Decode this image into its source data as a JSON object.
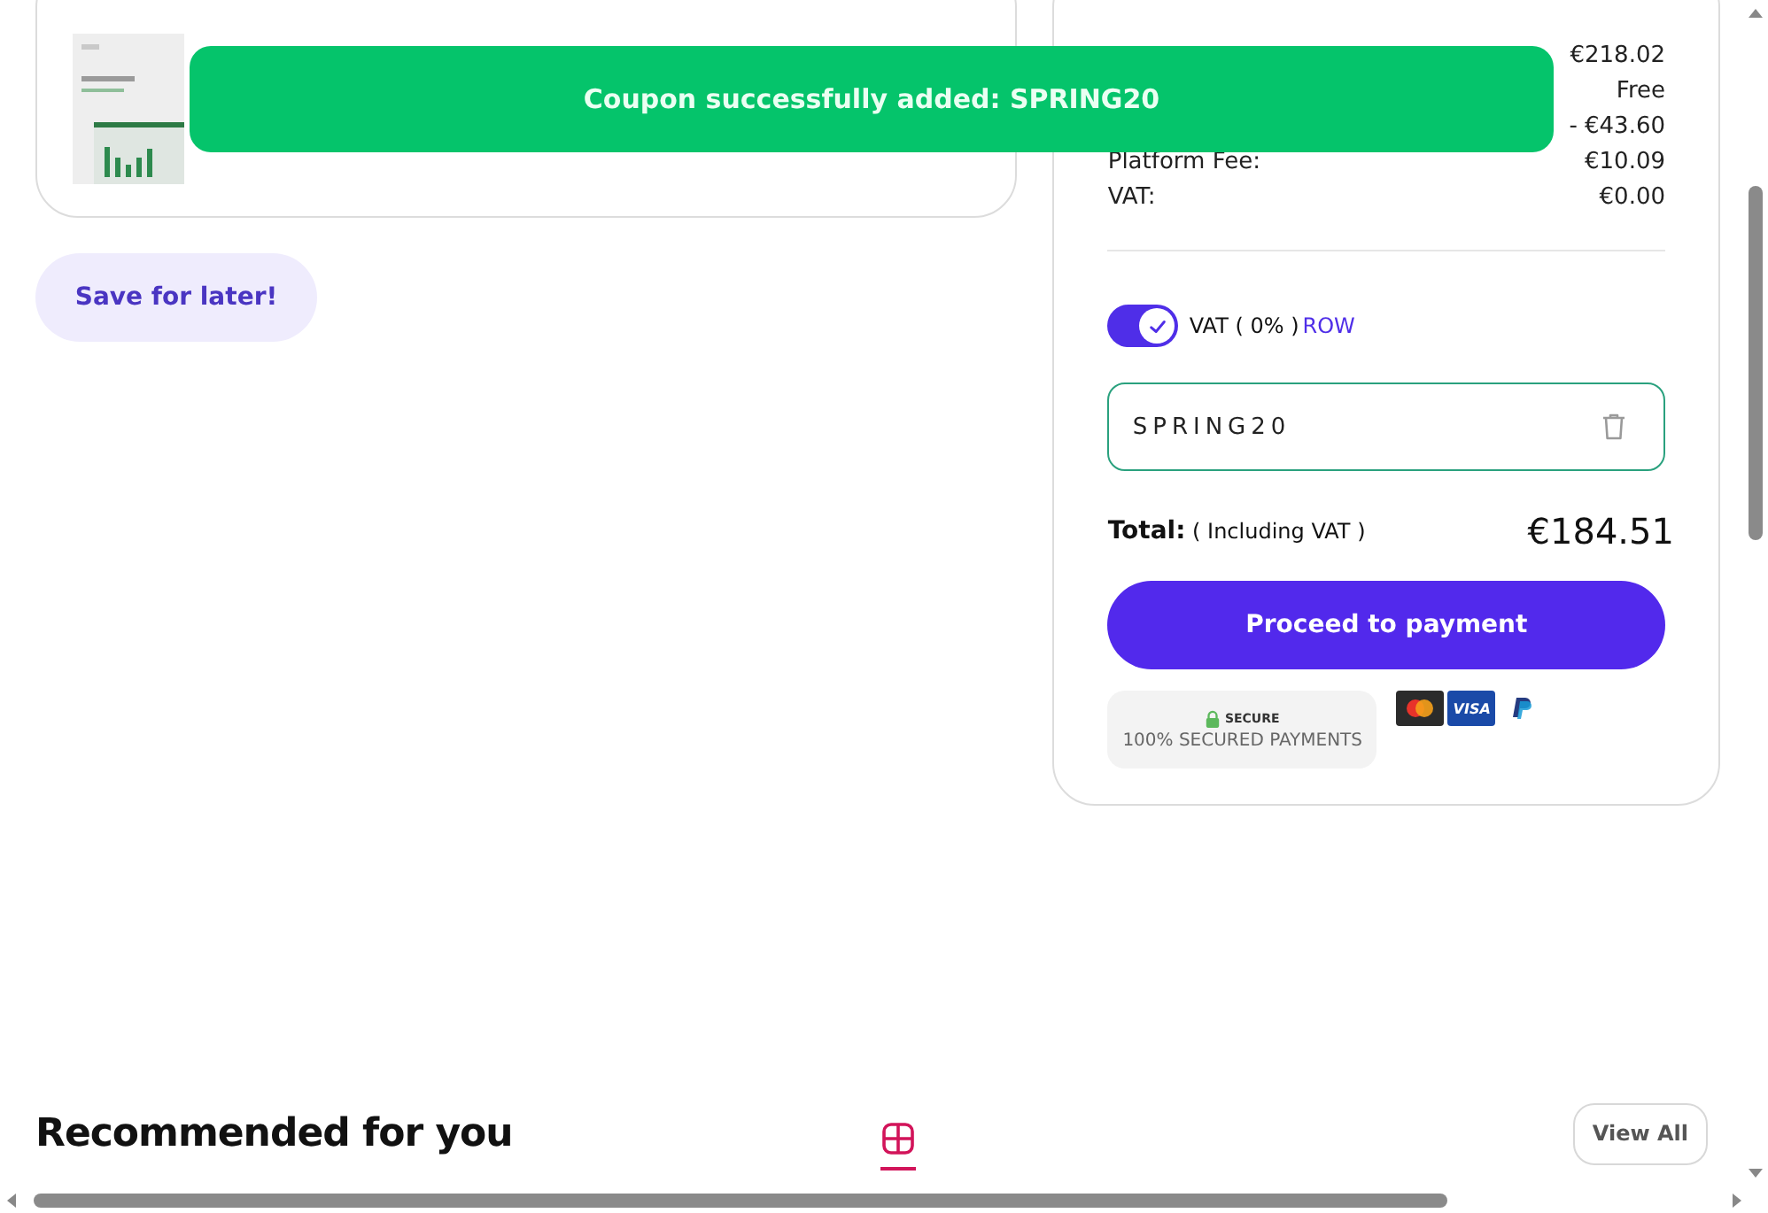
{
  "toast": {
    "message": "Coupon successfully added: SPRING20"
  },
  "save_button": {
    "label": "Save for later!"
  },
  "summary": {
    "rows": [
      {
        "value": "€218.02"
      },
      {
        "value": "Free"
      },
      {
        "value": "- €43.60"
      },
      {
        "label": "Platform Fee:",
        "value": "€10.09"
      },
      {
        "label": "VAT:",
        "value": "€0.00"
      }
    ],
    "vat_toggle": {
      "on": true,
      "label": "VAT ( 0% )",
      "link": "ROW"
    },
    "coupon_field": {
      "value": "SPRING20"
    },
    "total": {
      "label": "Total:",
      "note": "( Including VAT )",
      "amount": "€184.51"
    },
    "pay_button": {
      "label": "Proceed to payment"
    },
    "secure_badge": {
      "label": "SECURE",
      "caption": "100% SECURED PAYMENTS"
    },
    "payment_logos": [
      {
        "kind": "mastercard"
      },
      {
        "kind": "visa",
        "text": "VISA"
      },
      {
        "kind": "paypal"
      }
    ]
  },
  "recommended": {
    "title": "Recommended for you",
    "tabs": [
      {
        "kind": "grid",
        "selected": true
      }
    ],
    "view_all": "View All"
  }
}
